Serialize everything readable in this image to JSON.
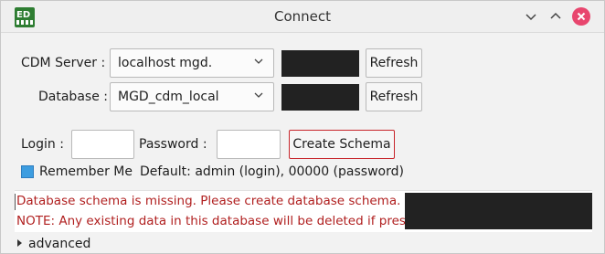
{
  "window": {
    "title": "Connect",
    "icon": "app-logo-icon",
    "controls": [
      "minimize-icon",
      "maximize-icon",
      "close-icon"
    ],
    "close_color": "#e8466e"
  },
  "server": {
    "label": "CDM Server :",
    "selected": "localhost mgd.",
    "refresh_label": "Refresh"
  },
  "database": {
    "label": "Database :",
    "selected": "MGD_cdm_local",
    "refresh_label": "Refresh"
  },
  "login": {
    "login_label": "Login :",
    "login_value": "",
    "password_label": "Password :",
    "password_value": "",
    "create_schema_label": "Create Schema"
  },
  "remember": {
    "label": "Remember Me",
    "checked": true,
    "default_hint": "Default: admin (login), 00000 (password)"
  },
  "messages": {
    "line1": "Database schema is missing. Please create database schema.",
    "line2": "NOTE: Any existing data in this database will be deleted if present!",
    "color": "#b01f1f"
  },
  "advanced": {
    "label": "advanced"
  },
  "colors": {
    "accent_border": "#c7252b",
    "checkbox": "#3d9de0",
    "redacted": "#222222"
  }
}
